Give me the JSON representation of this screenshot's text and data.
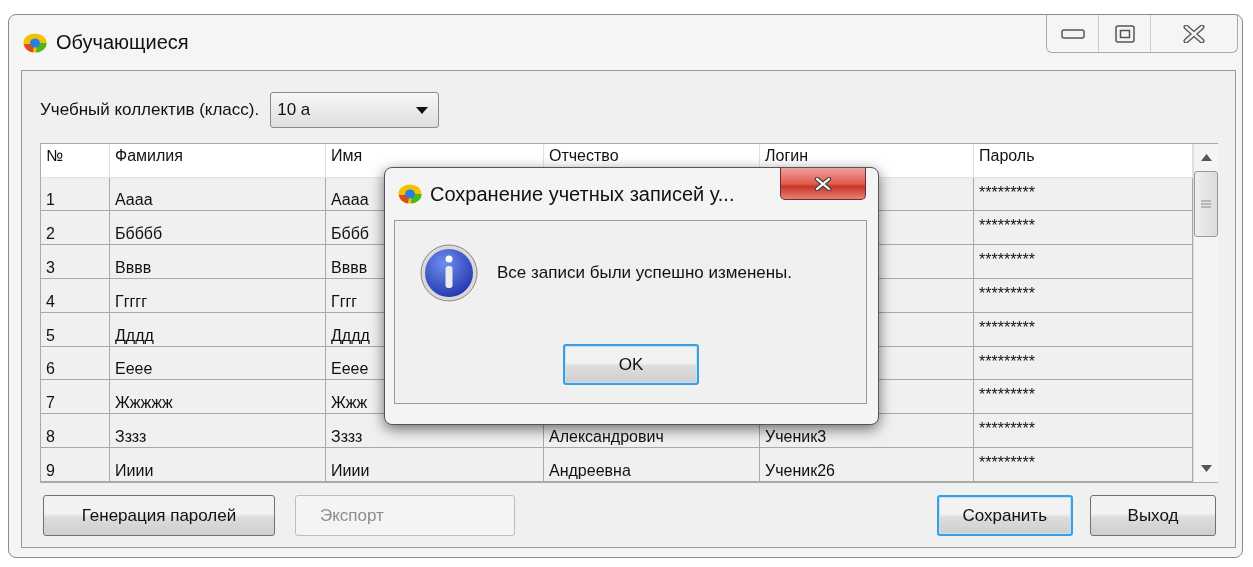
{
  "window": {
    "title": "Обучающиеся"
  },
  "class_selector": {
    "label": "Учебный коллектив (класс).",
    "value": "10 а"
  },
  "table": {
    "columns": [
      "№",
      "Фамилия",
      "Имя",
      "Отчество",
      "Логин",
      "Пароль"
    ],
    "rows": [
      {
        "number": "1",
        "surname": "Аааа",
        "name": "Аааа",
        "password": "*********"
      },
      {
        "number": "2",
        "surname": "Ббббб",
        "name": "Бббб",
        "password": "*********"
      },
      {
        "number": "3",
        "surname": "Вввв",
        "name": "Вввв",
        "password": "*********"
      },
      {
        "number": "4",
        "surname": "Ггггг",
        "name": "Гггг",
        "password": "*********"
      },
      {
        "number": "5",
        "surname": "Дддд",
        "name": "Дддд",
        "password": "*********"
      },
      {
        "number": "6",
        "surname": "Ееее",
        "name": "Ееее",
        "password": "*********"
      },
      {
        "number": "7",
        "surname": "Жжжжж",
        "name": "Жжж",
        "password": "*********"
      },
      {
        "number": "8",
        "surname": "Зззз",
        "name": "Зззз",
        "patronymic": "Александрович",
        "login": "Ученик3",
        "password": "*********"
      },
      {
        "number": "9",
        "surname": "Ииии",
        "name": "Ииии",
        "patronymic": "Андреевна",
        "login": "Ученик26",
        "password": "*********"
      }
    ]
  },
  "left_buttons": [
    {
      "label": "Генерация паролей",
      "disabled": false,
      "focused": false
    },
    {
      "label": "Экспорт",
      "disabled": true,
      "focused": false
    }
  ],
  "right_buttons": [
    {
      "label": "Сохранить",
      "disabled": false,
      "focused": true
    },
    {
      "label": "Выход",
      "disabled": false,
      "focused": false
    }
  ],
  "dialog": {
    "title": "Сохранение учетных записей у...",
    "message": "Все записи были успешно изменены.",
    "button": {
      "label": "OK",
      "focused": true
    }
  }
}
